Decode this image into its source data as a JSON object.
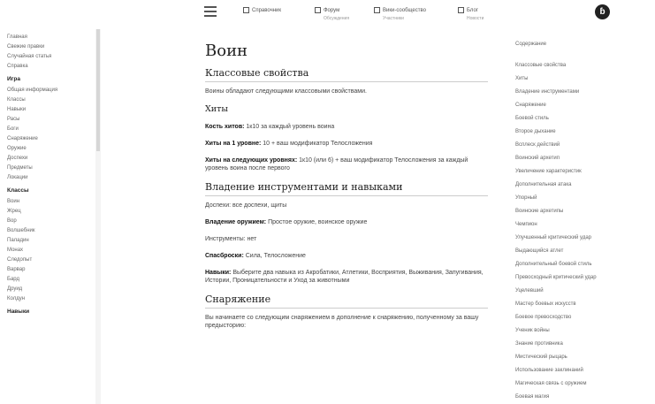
{
  "header": {
    "nav": [
      {
        "label": "Справочник",
        "sub": ""
      },
      {
        "label": "Форум",
        "sub": "Обсуждения"
      },
      {
        "label": "Вики-сообщество",
        "sub": "Участники"
      },
      {
        "label": "Блог",
        "sub": "Новости"
      }
    ]
  },
  "sidebar": [
    {
      "kind": "item",
      "label": "Главная"
    },
    {
      "kind": "item",
      "label": "Свежие правки"
    },
    {
      "kind": "item",
      "label": "Случайная статья"
    },
    {
      "kind": "item",
      "label": "Справка"
    },
    {
      "kind": "head",
      "label": "Игра"
    },
    {
      "kind": "item",
      "label": "Общая информация"
    },
    {
      "kind": "item",
      "label": "Классы"
    },
    {
      "kind": "item",
      "label": "Навыки"
    },
    {
      "kind": "item",
      "label": "Расы"
    },
    {
      "kind": "item",
      "label": "Боги"
    },
    {
      "kind": "item",
      "label": "Снаряжение"
    },
    {
      "kind": "item",
      "label": "Оружие"
    },
    {
      "kind": "item",
      "label": "Доспехи"
    },
    {
      "kind": "item",
      "label": "Предметы"
    },
    {
      "kind": "item",
      "label": "Локации"
    },
    {
      "kind": "head",
      "label": "Классы"
    },
    {
      "kind": "item",
      "label": "Воин"
    },
    {
      "kind": "item",
      "label": "Жрец"
    },
    {
      "kind": "item",
      "label": "Вор"
    },
    {
      "kind": "item",
      "label": "Волшебник"
    },
    {
      "kind": "item",
      "label": "Паладин"
    },
    {
      "kind": "item",
      "label": "Монах"
    },
    {
      "kind": "item",
      "label": "Следопыт"
    },
    {
      "kind": "item",
      "label": "Варвар"
    },
    {
      "kind": "item",
      "label": "Бард"
    },
    {
      "kind": "item",
      "label": "Друид"
    },
    {
      "kind": "item",
      "label": "Колдун"
    },
    {
      "kind": "head",
      "label": "Навыки"
    }
  ],
  "article": {
    "title": "Воин",
    "sections": [
      {
        "kind": "h2",
        "text": "Классовые свойства"
      },
      {
        "kind": "p",
        "text": "Воины обладают следующими классовыми свойствами."
      },
      {
        "kind": "h3",
        "text": "Хиты"
      },
      {
        "kind": "pb",
        "bold": "Кость хитов:",
        "rest": " 1к10 за каждый уровень воина"
      },
      {
        "kind": "pb",
        "bold": "Хиты на 1 уровне:",
        "rest": " 10 + ваш модификатор Телосложения"
      },
      {
        "kind": "pb",
        "bold": "Хиты на следующих уровнях:",
        "rest": " 1к10 (или 6) + ваш модификатор Телосложения за каждый уровень воина после первого"
      },
      {
        "kind": "h2",
        "text": "Владение инструментами и навыками"
      },
      {
        "kind": "p",
        "text": "Доспехи: все доспехи, щиты"
      },
      {
        "kind": "pb",
        "bold": "Владение оружием:",
        "rest": " Простое оружие, воинское оружие"
      },
      {
        "kind": "p",
        "text": "Инструменты: нет"
      },
      {
        "kind": "pb",
        "bold": "Спасброски:",
        "rest": " Сила, Телосложение"
      },
      {
        "kind": "pb",
        "bold": "Навыки:",
        "rest": " Выберите два навыка из Акробатики, Атлетики, Восприятия, Выживания, Запугивания, Истории, Проницательности и Уход за животными"
      },
      {
        "kind": "h2",
        "text": "Снаряжение"
      },
      {
        "kind": "p",
        "text": "Вы начинаете со следующим снаряжением в дополнение к снаряжению, полученному за вашу предысторию:"
      }
    ]
  },
  "toc": [
    "Содержание",
    "Классовые свойства",
    "Хиты",
    "Владение инструментами",
    "Снаряжение",
    "Боевой стиль",
    "Второе дыхание",
    "Всплеск действий",
    "Воинский архетип",
    "Увеличение характеристик",
    "Дополнительная атака",
    "Упорный",
    "Воинские архетипы",
    "Чемпион",
    "Улучшенный критический удар",
    "Выдающийся атлет",
    "Дополнительный боевой стиль",
    "Превосходный критический удар",
    "Уцелевший",
    "Мастер боевых искусств",
    "Боевое превосходство",
    "Ученик войны",
    "Знание противника",
    "Мистический рыцарь",
    "Использование заклинаний",
    "Магическая связь с оружием",
    "Боевая магия"
  ]
}
